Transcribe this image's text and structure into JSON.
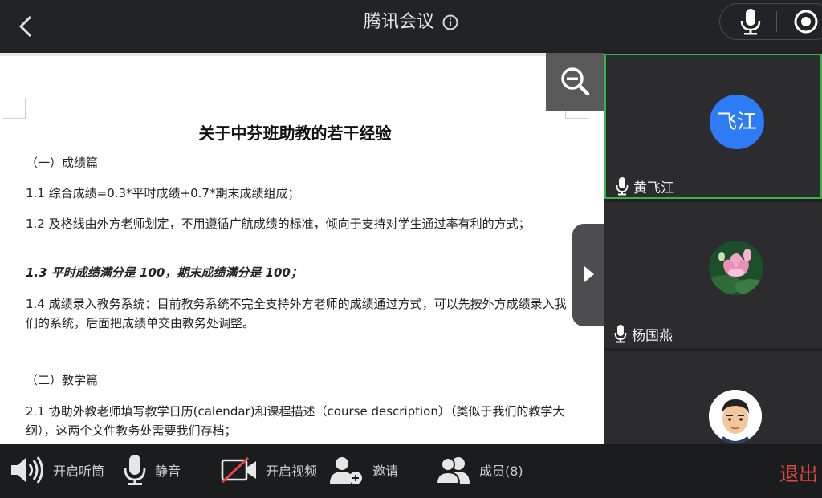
{
  "header": {
    "title": "腾讯会议",
    "back_icon": "chevron-left-icon",
    "info_icon": "info-icon",
    "mic_icon": "microphone-icon",
    "record_icon": "record-icon"
  },
  "document": {
    "title": "关于中芬班助教的若干经验",
    "paragraphs": [
      "（一）成绩篇",
      "1.1 综合成绩=0.3*平时成绩+0.7*期末成绩组成；",
      "1.2 及格线由外方老师划定，不用遵循广航成绩的标准，倾向于支持对学生通过率有利的方式；",
      "1.3 平时成绩满分是 100，期末成绩满分是 100；",
      "1.4 成绩录入教务系统：目前教务系统不完全支持外方老师的成绩通过方式，可以先按外方成绩录入我们的系统，后面把成绩单交由教务处调整。",
      "（二）教学篇",
      "2.1 协助外教老师填写教学日历(calendar)和课程描述（course description）（类似于我们的教学大纲），这两个文件教务处需要我们存档；"
    ]
  },
  "participants": [
    {
      "name": "黄飞江",
      "avatar_text": "飞江",
      "speaking": true
    },
    {
      "name": "杨国燕",
      "avatar": "lotus-photo"
    },
    {
      "name": "",
      "avatar": "cartoon-man"
    }
  ],
  "toolbar": {
    "speaker_label": "开启听筒",
    "mute_label": "静音",
    "video_label": "开启视频",
    "invite_label": "邀请",
    "members_label": "成员(8)",
    "exit_label": "退出"
  },
  "colors": {
    "accent_blue": "#2d7bf5",
    "speaking_border": "#3cb34a",
    "exit_red": "#e4473f"
  }
}
